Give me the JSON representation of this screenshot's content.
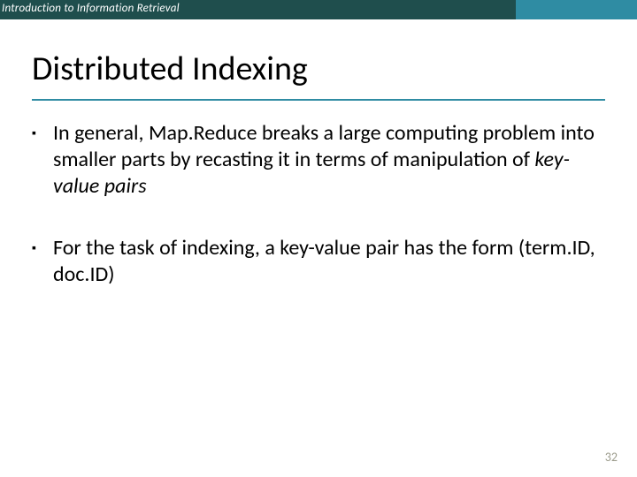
{
  "header": {
    "course": "Introduction to Information Retrieval"
  },
  "title": "Distributed Indexing",
  "bullets": [
    {
      "pre": "In general, Map.Reduce breaks a large computing problem into smaller parts by recasting it in terms of manipulation of ",
      "em": "key-value pairs",
      "post": ""
    },
    {
      "pre": "For the task of indexing, a key-value pair has the form (term.ID, doc.ID)",
      "em": "",
      "post": ""
    }
  ],
  "page_number": "32"
}
